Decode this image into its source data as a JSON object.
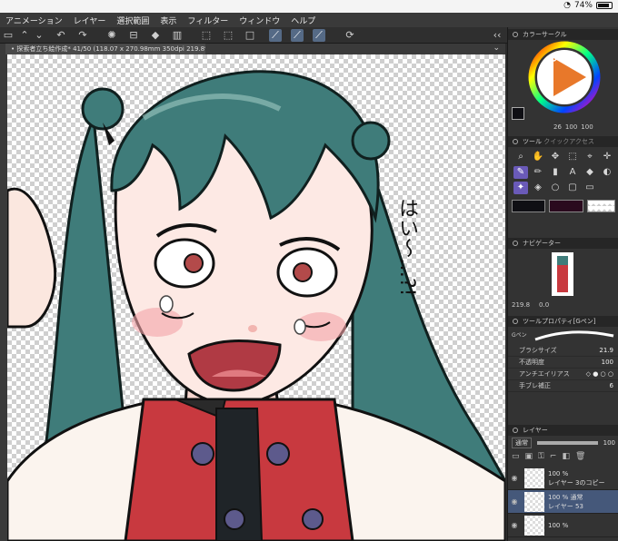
{
  "status": {
    "battery": "74%"
  },
  "menu": [
    "アニメーション",
    "レイヤー",
    "選択範囲",
    "表示",
    "フィルター",
    "ウィンドウ",
    "ヘルプ"
  ],
  "document": {
    "tab_title": "• 探索者立ち絵作成* 41/50 (118.07 x 270.98mm 350dpi 219.8%)"
  },
  "panels": {
    "color": {
      "title": "カラーサークル",
      "h": "26",
      "s": "100",
      "v": "100"
    },
    "tools": {
      "title": "ツール",
      "subtitle": "クイックアクセス"
    },
    "navigator": {
      "title": "ナビゲーター",
      "zoom": "219.8",
      "angle": "0.0"
    },
    "tool_property": {
      "title": "ツールプロパティ",
      "tool_name": "[Gペン]",
      "brush_label": "Gペン",
      "brush_size_label": "ブラシサイズ",
      "brush_size": "21.9",
      "opacity_label": "不透明度",
      "opacity": "100",
      "antialias_label": "アンチエイリアス",
      "stabilization_label": "手ブレ補正",
      "stabilization": "6"
    },
    "layers": {
      "title": "レイヤー",
      "blend": "通常",
      "opacity": "100",
      "items": [
        {
          "percent": "100 %",
          "mode": "",
          "name": "レイヤー 3のコピー"
        },
        {
          "percent": "100 %",
          "mode": "通常",
          "name": "レイヤー 53"
        },
        {
          "percent": "100 %",
          "mode": "",
          "name": ""
        }
      ]
    }
  },
  "artwork": {
    "text": "はい〜…?!"
  },
  "colors": {
    "main": "#0f0f14",
    "sub": "#2a0a1e",
    "accent_selected": "#556a86"
  }
}
